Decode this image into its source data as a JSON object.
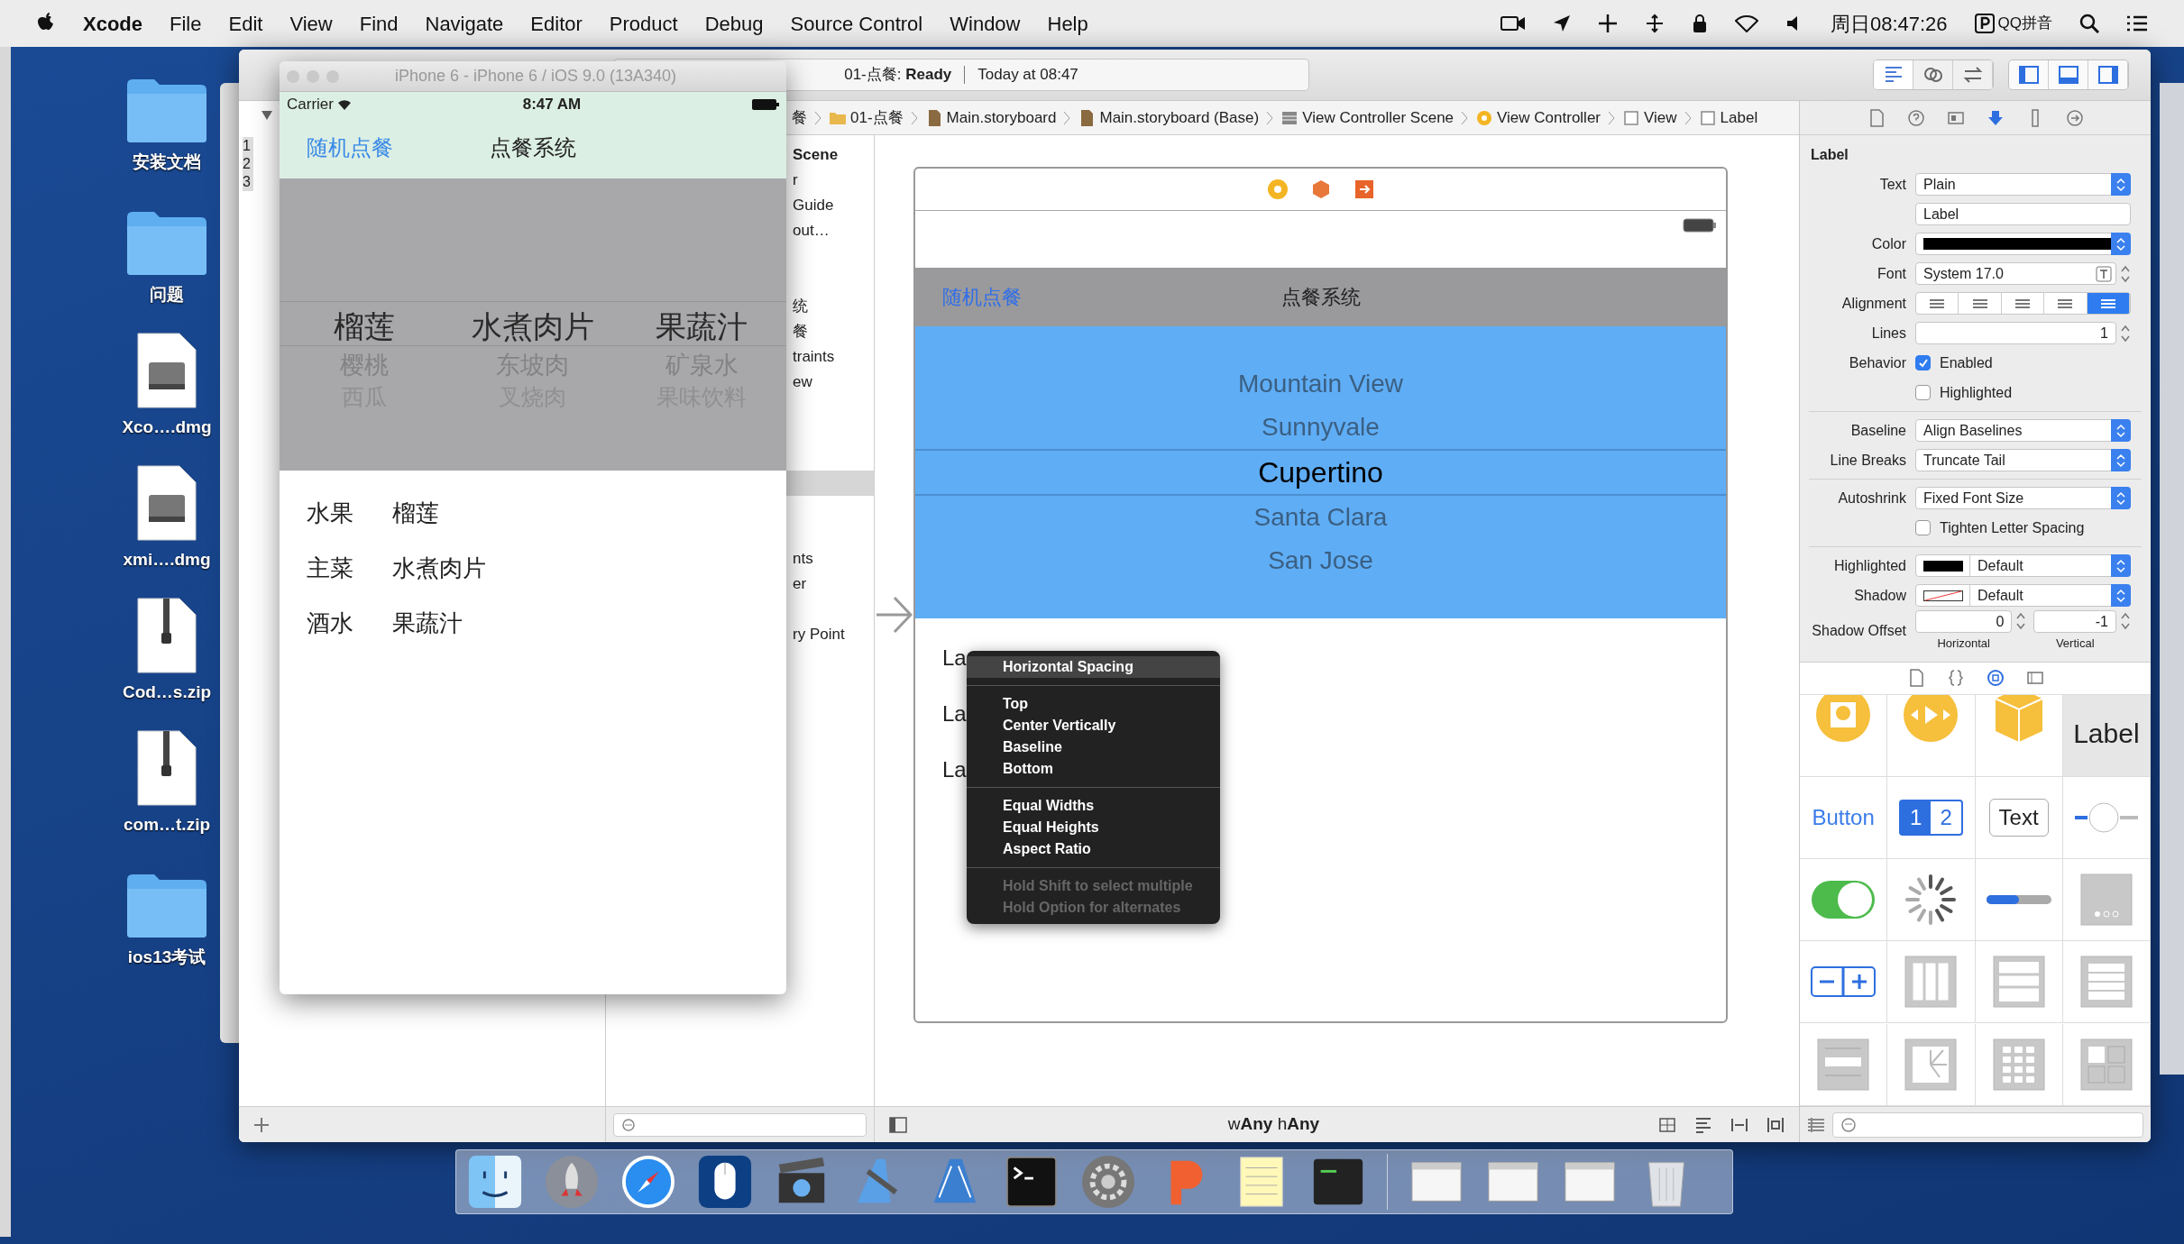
{
  "menu_bar": {
    "app": "Xcode",
    "items": [
      "File",
      "Edit",
      "View",
      "Find",
      "Navigate",
      "Editor",
      "Product",
      "Debug",
      "Source Control",
      "Window",
      "Help"
    ],
    "clock": "周日08:47:26",
    "input_method": "QQ拼音"
  },
  "desktop_icons": [
    {
      "label": "安装文档",
      "kind": "folder"
    },
    {
      "label": "问题",
      "kind": "folder"
    },
    {
      "label": "Xco….dmg",
      "kind": "dmg"
    },
    {
      "label": "xmi….dmg",
      "kind": "dmg"
    },
    {
      "label": "Cod…s.zip",
      "kind": "zip"
    },
    {
      "label": "com…t.zip",
      "kind": "zip"
    },
    {
      "label": "ios13考试",
      "kind": "folder"
    }
  ],
  "simulator": {
    "title": "iPhone 6 - iPhone 6 / iOS 9.0 (13A340)",
    "carrier": "Carrier",
    "time": "8:47 AM",
    "nav_button": "随机点餐",
    "nav_title": "点餐系统",
    "picker": [
      {
        "items": [
          {
            "text": "榴莲",
            "selected": true
          },
          {
            "text": "樱桃",
            "selected": false
          },
          {
            "text": "西瓜",
            "selected": false
          }
        ]
      },
      {
        "items": [
          {
            "text": "水煮肉片",
            "selected": true
          },
          {
            "text": "东坡肉",
            "selected": false
          },
          {
            "text": "叉烧肉",
            "selected": false
          }
        ]
      },
      {
        "items": [
          {
            "text": "果蔬汁",
            "selected": true
          },
          {
            "text": "矿泉水",
            "selected": false
          },
          {
            "text": "果味饮料",
            "selected": false
          }
        ]
      }
    ],
    "rows": [
      {
        "category": "水果",
        "value": "榴莲"
      },
      {
        "category": "主菜",
        "value": "水煮肉片"
      },
      {
        "category": "酒水",
        "value": "果蔬汁"
      }
    ]
  },
  "xcode": {
    "activity": {
      "status": "01-点餐: **Ready**",
      "time": "Today at 08:47"
    },
    "editor_modes": [
      {
        "selected": true
      },
      {
        "selected": false
      },
      {
        "selected": false
      }
    ],
    "panel_toggles": [
      {
        "on": true
      },
      {
        "on": true
      },
      {
        "on": true
      }
    ],
    "navigator": {
      "line_numbers": [
        "1",
        "2",
        "3"
      ]
    },
    "jump_bar": [
      {
        "text": "餐",
        "kind": "none"
      },
      {
        "text": "01-点餐",
        "kind": "folder"
      },
      {
        "text": "Main.storyboard",
        "kind": "file"
      },
      {
        "text": "Main.storyboard (Base)",
        "kind": "file"
      },
      {
        "text": "View Controller Scene",
        "kind": "scene"
      },
      {
        "text": "View Controller",
        "kind": "controller"
      },
      {
        "text": "View",
        "kind": "view"
      },
      {
        "text": "Label",
        "kind": "view"
      }
    ],
    "outline": [
      {
        "text": "Scene",
        "kind": "header"
      },
      {
        "text": "r",
        "kind": "item"
      },
      {
        "text": "Guide",
        "kind": "item"
      },
      {
        "text": "out…",
        "kind": "item"
      },
      {
        "text": "统",
        "kind": "item"
      },
      {
        "text": "餐",
        "kind": "item"
      },
      {
        "text": "traints",
        "kind": "item"
      },
      {
        "text": "ew",
        "kind": "item"
      },
      {
        "text": "nts",
        "kind": "item"
      },
      {
        "text": "er",
        "kind": "item"
      },
      {
        "text": "ry Point",
        "kind": "item"
      }
    ],
    "scene": {
      "nav_button": "随机点餐",
      "nav_title": "点餐系统",
      "picker": [
        {
          "text": "Mountain View",
          "selected": false
        },
        {
          "text": "Sunnyvale",
          "selected": false
        },
        {
          "text": "Cupertino",
          "selected": true
        },
        {
          "text": "Santa Clara",
          "selected": false
        },
        {
          "text": "San Jose",
          "selected": false
        }
      ],
      "labels": [
        "La",
        "La",
        "La"
      ]
    },
    "context_menu": [
      {
        "kind": "item",
        "text": "Horizontal Spacing",
        "selected": true
      },
      {
        "kind": "separator"
      },
      {
        "kind": "item",
        "text": "Top",
        "selected": false
      },
      {
        "kind": "item",
        "text": "Center Vertically",
        "selected": false
      },
      {
        "kind": "item",
        "text": "Baseline",
        "selected": false
      },
      {
        "kind": "item",
        "text": "Bottom",
        "selected": false
      },
      {
        "kind": "separator"
      },
      {
        "kind": "item",
        "text": "Equal Widths",
        "selected": false
      },
      {
        "kind": "item",
        "text": "Equal Heights",
        "selected": false
      },
      {
        "kind": "item",
        "text": "Aspect Ratio",
        "selected": false
      },
      {
        "kind": "separator"
      },
      {
        "kind": "hint",
        "text": "Hold Shift to select multiple"
      },
      {
        "kind": "hint",
        "text": "Hold Option for alternates"
      }
    ],
    "size_class": "w**Any** h**Any**",
    "inspector_tabs": [
      {
        "selected": false
      },
      {
        "selected": false
      },
      {
        "selected": false
      },
      {
        "selected": true
      },
      {
        "selected": false
      },
      {
        "selected": false
      }
    ],
    "inspector": {
      "title": "Label",
      "rows": [
        {
          "kind": "popup",
          "label": "Text",
          "value": "Plain"
        },
        {
          "kind": "field",
          "value": "Label"
        },
        {
          "kind": "color",
          "label": "Color"
        },
        {
          "kind": "font",
          "label": "Font",
          "value": "System 17.0"
        },
        {
          "kind": "segmented",
          "label": "Alignment",
          "segments": [
            {
              "selected": false
            },
            {
              "selected": false
            },
            {
              "selected": false
            },
            {
              "selected": false
            },
            {
              "selected": true
            }
          ]
        },
        {
          "kind": "stepper",
          "label": "Lines",
          "value": "1"
        },
        {
          "kind": "checkbox",
          "label": "Behavior",
          "text": "Enabled",
          "checked": true
        },
        {
          "kind": "checkbox",
          "text": "Highlighted",
          "checked": false
        },
        {
          "kind": "divider"
        },
        {
          "kind": "popup",
          "label": "Baseline",
          "value": "Align Baselines"
        },
        {
          "kind": "popup",
          "label": "Line Breaks",
          "value": "Truncate Tail"
        },
        {
          "kind": "divider"
        },
        {
          "kind": "popup",
          "label": "Autoshrink",
          "value": "Fixed Font Size"
        },
        {
          "kind": "checkbox",
          "text": "Tighten Letter Spacing",
          "checked": false
        },
        {
          "kind": "divider"
        },
        {
          "kind": "color_popup",
          "label": "Highlighted",
          "value": "Default"
        },
        {
          "kind": "shadow_popup",
          "label": "Shadow",
          "value": "Default"
        },
        {
          "kind": "offset",
          "label": "Shadow Offset",
          "values": [
            {
              "value": "0",
              "caption": "Horizontal"
            },
            {
              "value": "-1",
              "caption": "Vertical"
            }
          ]
        }
      ]
    },
    "library_tabs": [
      {
        "selected": false
      },
      {
        "selected": false
      },
      {
        "selected": true
      },
      {
        "selected": false
      }
    ],
    "library": [
      {
        "kind": "camera",
        "selected": false
      },
      {
        "kind": "media",
        "selected": false
      },
      {
        "kind": "cube",
        "selected": false
      },
      {
        "kind": "label",
        "text": "Label",
        "selected": true
      },
      {
        "kind": "button",
        "text": "Button",
        "selected": false
      },
      {
        "kind": "segmented",
        "segments": [
          "1",
          "2"
        ],
        "selected": false
      },
      {
        "kind": "textfield",
        "text": "Text",
        "selected": false
      },
      {
        "kind": "slider",
        "selected": false
      },
      {
        "kind": "switch",
        "selected": false
      },
      {
        "kind": "spinner",
        "selected": false
      },
      {
        "kind": "progress",
        "selected": false
      },
      {
        "kind": "pagecontrol",
        "selected": false
      },
      {
        "kind": "stepper",
        "selected": false
      },
      {
        "kind": "columns",
        "selected": false
      },
      {
        "kind": "rows",
        "selected": false
      },
      {
        "kind": "table",
        "selected": false
      },
      {
        "kind": "cell",
        "selected": false
      },
      {
        "kind": "image",
        "selected": false
      },
      {
        "kind": "grid",
        "selected": false
      },
      {
        "kind": "container",
        "selected": false
      }
    ]
  },
  "dock": [
    {
      "kind": "finder"
    },
    {
      "kind": "rocket"
    },
    {
      "kind": "compass"
    },
    {
      "kind": "mouse"
    },
    {
      "kind": "film"
    },
    {
      "kind": "hammer"
    },
    {
      "kind": "blueprint"
    },
    {
      "kind": "terminal"
    },
    {
      "kind": "gear"
    },
    {
      "kind": "p-app"
    },
    {
      "kind": "notes"
    },
    {
      "kind": "console"
    },
    {
      "kind": "separator"
    },
    {
      "kind": "window"
    },
    {
      "kind": "window"
    },
    {
      "kind": "window"
    },
    {
      "kind": "trash"
    }
  ]
}
